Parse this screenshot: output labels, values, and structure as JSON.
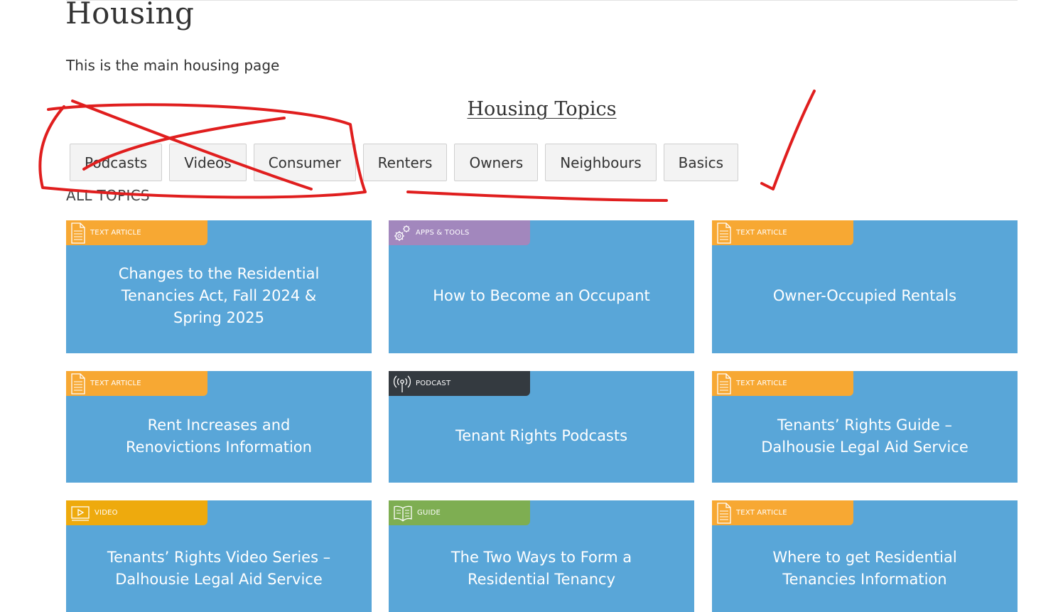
{
  "page": {
    "title": "Housing",
    "intro": "This is the main housing page",
    "topics_heading": "Housing Topics",
    "all_topics_label": "ALL TOPICS"
  },
  "filters": [
    "Podcasts",
    "Videos",
    "Consumer",
    "Renters",
    "Owners",
    "Neighbours",
    "Basics"
  ],
  "colors": {
    "card_bg": "#59a6d8",
    "text_article": "#f7a833",
    "apps_tools": "#a287bd",
    "podcast": "#343a40",
    "video": "#eeaa0d",
    "guide": "#7eae52",
    "annotation_red": "#e01e1e"
  },
  "cards": [
    {
      "badge": "TEXT ARTICLE",
      "badge_icon": "document-icon",
      "title": "Changes to the Residential Tenancies Act, Fall 2024 & Spring 2025"
    },
    {
      "badge": "APPS & TOOLS",
      "badge_icon": "gears-icon",
      "title": "How to Become an Occupant"
    },
    {
      "badge": "TEXT ARTICLE",
      "badge_icon": "document-icon",
      "title": "Owner-Occupied Rentals"
    },
    {
      "badge": "TEXT ARTICLE",
      "badge_icon": "document-icon",
      "title": "Rent Increases and Renovictions Information"
    },
    {
      "badge": "PODCAST",
      "badge_icon": "broadcast-icon",
      "title": "Tenant Rights Podcasts"
    },
    {
      "badge": "TEXT ARTICLE",
      "badge_icon": "document-icon",
      "title": "Tenants’ Rights Guide – Dalhousie Legal Aid Service"
    },
    {
      "badge": "VIDEO",
      "badge_icon": "video-play-icon",
      "title": "Tenants’ Rights Video Series – Dalhousie Legal Aid Service"
    },
    {
      "badge": "GUIDE",
      "badge_icon": "open-book-icon",
      "title": "The Two Ways to Form a Residential Tenancy"
    },
    {
      "badge": "TEXT ARTICLE",
      "badge_icon": "document-icon",
      "title": "Where to get Residential Tenancies Information"
    }
  ]
}
